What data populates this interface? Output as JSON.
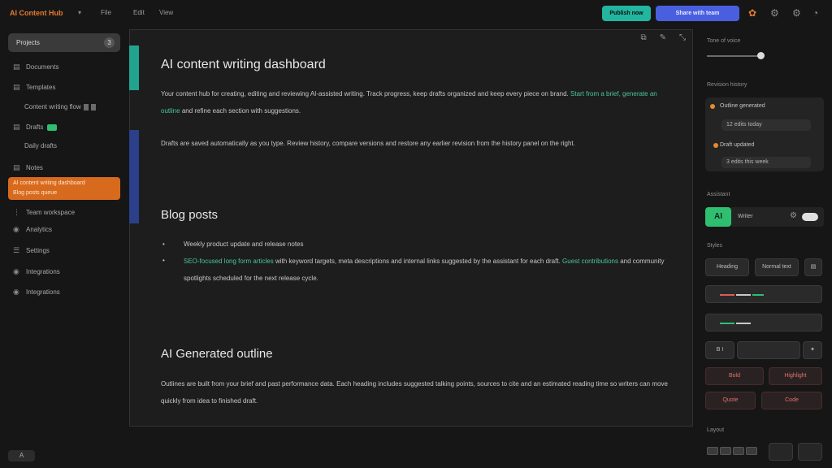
{
  "topbar": {
    "brand": "AI Content Hub",
    "menu": [
      "File",
      "Edit",
      "View"
    ],
    "publish_label": "Publish now",
    "share_label": "Share with team",
    "colors": {
      "accent_teal": "#22b5a0",
      "accent_blue": "#4a5fe0",
      "brand_orange": "#e67a2e"
    }
  },
  "sidebar": {
    "active": {
      "label": "Projects",
      "badge": "3"
    },
    "items": [
      {
        "label": "Documents",
        "icon": "doc-icon"
      },
      {
        "label": "Templates",
        "icon": "template-icon"
      },
      {
        "label": "Drafts",
        "icon": "draft-icon"
      },
      {
        "label": "Notes",
        "icon": "note-icon"
      }
    ],
    "subitems": [
      "Content writing flow",
      "Daily drafts"
    ],
    "orange_card": [
      "AI content writing dashboard",
      "Blog posts queue"
    ],
    "bottom_items": [
      {
        "label": "Team workspace",
        "icon": "team-icon"
      },
      {
        "label": "Analytics",
        "icon": "analytics-icon"
      },
      {
        "label": "Settings",
        "icon": "settings-icon"
      },
      {
        "label": "Integrations",
        "icon": "plug-icon"
      }
    ],
    "footer_label": "A"
  },
  "editor": {
    "title": "AI content writing dashboard",
    "para1_a": "Your content hub for creating, editing and reviewing AI-assisted writing. Track progress, keep drafts organized and keep every piece on brand.",
    "para1_hl": "Start from a brief, generate an outline",
    "para1_b": "and refine each section with suggestions.",
    "para2": "Drafts are saved automatically as you type. Review history, compare versions and restore any earlier revision from the history panel on the right.",
    "section2": "Blog posts",
    "bullet1": "Weekly product update and release notes",
    "bullet2_hl": "SEO-focused long form articles",
    "bullet2_rest": "with keyword targets, meta descriptions and internal links suggested by the assistant for each draft.",
    "bullet2_line2_hl": "Guest contributions",
    "bullet2_line2": "and community spotlights scheduled for the next release cycle.",
    "section3": "AI Generated outline",
    "para3": "Outlines are built from your brief and past performance data. Each heading includes suggested talking points, sources to cite and an estimated reading time so writers can move quickly from idea to finished draft."
  },
  "right_panel": {
    "tone_label": "Tone of voice",
    "tone_value": 0.95,
    "history_label": "Revision history",
    "history": [
      {
        "title": "Outline generated",
        "meta": "12 edits today"
      },
      {
        "title": "Draft updated",
        "meta": "3 edits this week"
      }
    ],
    "agent_label": "Assistant",
    "agent_badge": "AI",
    "agent_name": "Writer",
    "style_label": "Styles",
    "pill_labels": [
      "Heading",
      "Normal text",
      "Bold",
      "Highlight",
      "Quote",
      "Code"
    ],
    "footer_label": "Layout"
  }
}
